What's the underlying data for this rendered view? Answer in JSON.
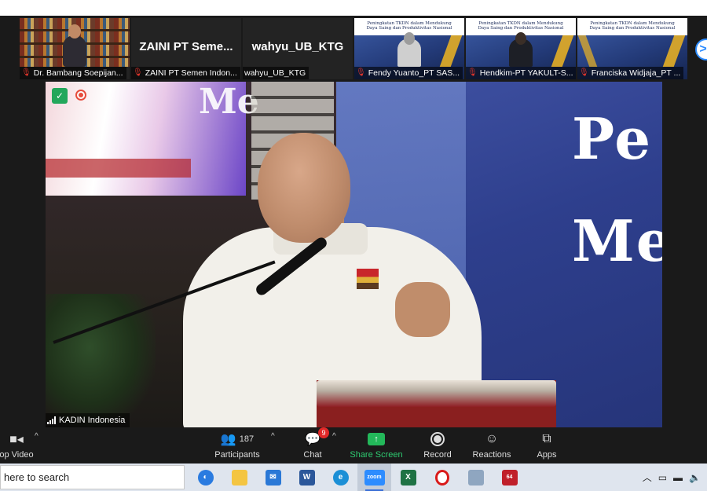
{
  "gallery": [
    {
      "caption": "Dr. Bambang Soepijan...",
      "muted": true,
      "type": "video-books"
    },
    {
      "caption": "ZAINI PT Semen Indon...",
      "muted": true,
      "big_name": "ZAINI  PT  Seme...",
      "type": "name"
    },
    {
      "caption": "wahyu_UB_KTG",
      "muted": false,
      "big_name": "wahyu_UB_KTG",
      "type": "name"
    },
    {
      "caption": "Fendy Yuanto_PT SAS...",
      "muted": true,
      "type": "slide",
      "slide_title": "Peningkatan TKDN dalam Mendukung",
      "slide_sub": "Daya Saing dan Produktivitas Nasional"
    },
    {
      "caption": "Hendkim-PT YAKULT-S...",
      "muted": true,
      "type": "slide",
      "slide_title": "Peningkatan TKDN dalam Mendukung",
      "slide_sub": "Daya Saing dan Produktivitas Nasional"
    },
    {
      "caption": "Franciska Widjaja_PT ...",
      "muted": true,
      "type": "slide",
      "slide_title": "Peningkatan TKDN dalam Mendukung",
      "slide_sub": "Daya Saing dan Produktivitas Nasional"
    }
  ],
  "next_arrow": ">",
  "main": {
    "speaker_label": "KADIN Indonesia",
    "slide_word1": "Pe",
    "slide_word2": "Me",
    "screen_word": "Me"
  },
  "toolbar": {
    "video_label": "op Video",
    "participants_label": "Participants",
    "participants_count": "187",
    "chat_label": "Chat",
    "chat_badge": "9",
    "share_label": "Share Screen",
    "record_label": "Record",
    "reactions_label": "Reactions",
    "apps_label": "Apps"
  },
  "taskbar": {
    "search_text": "here to search",
    "apps": [
      "task-view",
      "file-explorer",
      "mail",
      "word",
      "edge",
      "zoom",
      "excel",
      "opera",
      "photos",
      "app-64"
    ],
    "zoom_label": "zoom",
    "word_label": "W",
    "excel_label": "X",
    "badge_64": "64"
  },
  "colors": {
    "accent_green": "#2ecc71",
    "badge_red": "#e02828",
    "zoom_blue": "#2d8cff"
  }
}
